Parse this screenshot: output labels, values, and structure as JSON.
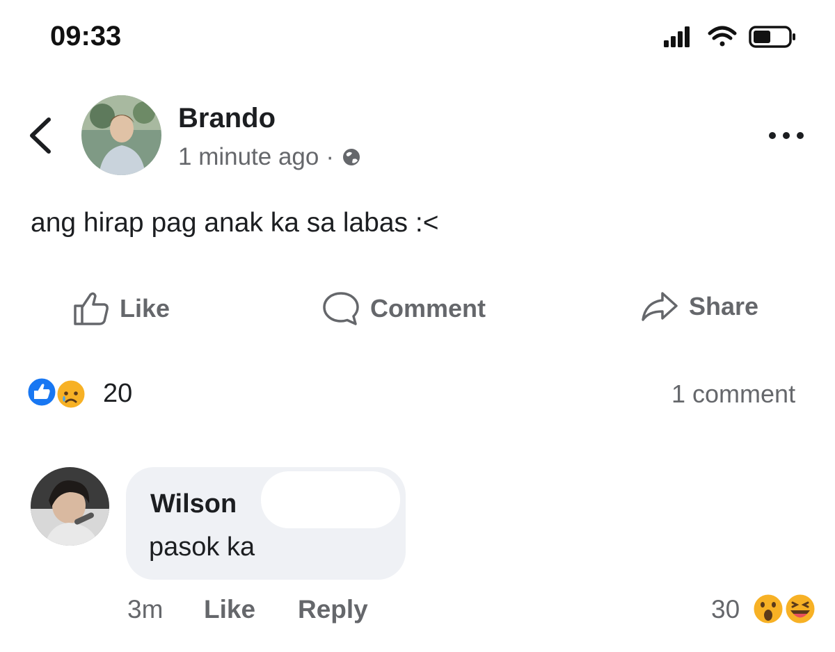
{
  "status_bar": {
    "time": "09:33",
    "icons": [
      "signal-icon",
      "wifi-icon",
      "battery-icon"
    ]
  },
  "post": {
    "author": "Brando",
    "timestamp": "1 minute ago",
    "separator": "·",
    "audience_icon": "globe-icon",
    "text": "ang hirap pag anak ka sa labas :<",
    "actions": {
      "like": "Like",
      "comment": "Comment",
      "share": "Share"
    },
    "reactions": {
      "icons": [
        "like-reaction-icon",
        "sad-reaction-icon"
      ],
      "count": "20"
    },
    "comment_count": "1 comment"
  },
  "comment": {
    "author": "Wilson",
    "text": "pasok ka",
    "age": "3m",
    "like_label": "Like",
    "reply_label": "Reply",
    "reactions": {
      "count": "30",
      "icons": [
        "wow-reaction-icon",
        "haha-reaction-icon"
      ]
    }
  },
  "colors": {
    "text_primary": "#1c1e21",
    "text_secondary": "#65676b",
    "bubble_bg": "#eff1f5",
    "like_blue": "#1877f2",
    "emoji_yellow": "#f7b125"
  }
}
